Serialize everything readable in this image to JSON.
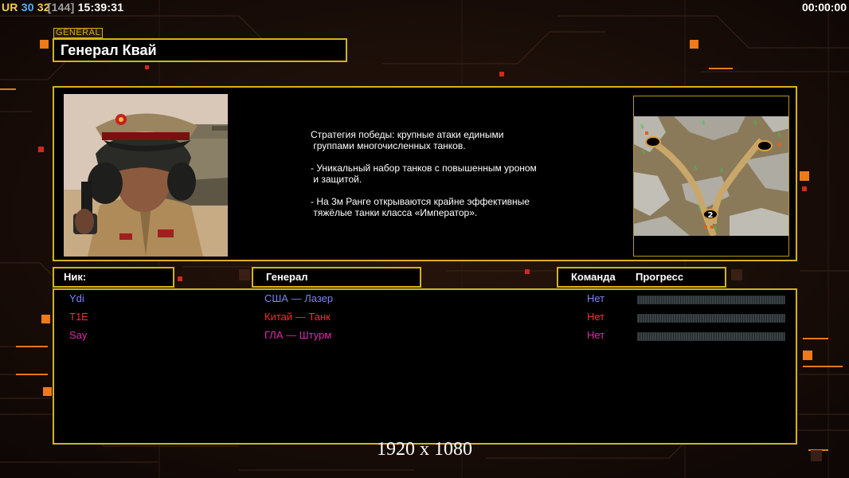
{
  "hud": {
    "label": "UR",
    "fps": "30",
    "value": "32",
    "bracket": "[144]",
    "clock": "15:39:31",
    "timer": "00:00:00"
  },
  "colors": {
    "accent": "#d4b21a",
    "hud_label": "#f0d040",
    "hud_fps": "#4fb3ff",
    "hud_value": "#f0d040",
    "hud_bracket": "#a0a0a0",
    "player_usa": "#8080ff",
    "player_china": "#ff2a2a",
    "player_gla": "#e02aa8"
  },
  "general": {
    "tag": "GENERAL",
    "title": "Генерал Квай",
    "portrait_icon": "general-portrait",
    "description": [
      "Стратегия победы: крупные атаки едиными\n группами многочисленных танков.",
      "- Уникальный набор танков с повышенным уроном\n и защитой.",
      "- На 3м Ранге открываются крайне эффективные\n тяжёлые танки класса «Император»."
    ],
    "minimap_icon": "map-preview",
    "minimap_marker": "2"
  },
  "table": {
    "headers": {
      "nick": "Ник:",
      "general": "Генерал",
      "team": "Команда",
      "progress": "Прогресс"
    },
    "rows": [
      {
        "nick": "Ydi",
        "general": "США — Лазер",
        "team": "Нет",
        "color": "#8080ff",
        "progress": 0
      },
      {
        "nick": "T1E",
        "general": "Китай — Танк",
        "team": "Нет",
        "color": "#ff2a2a",
        "progress": 0
      },
      {
        "nick": "Say",
        "general": "ГЛА — Штурм",
        "team": "Нет",
        "color": "#e02aa8",
        "progress": 0
      }
    ]
  },
  "resolution": "1920 x 1080"
}
